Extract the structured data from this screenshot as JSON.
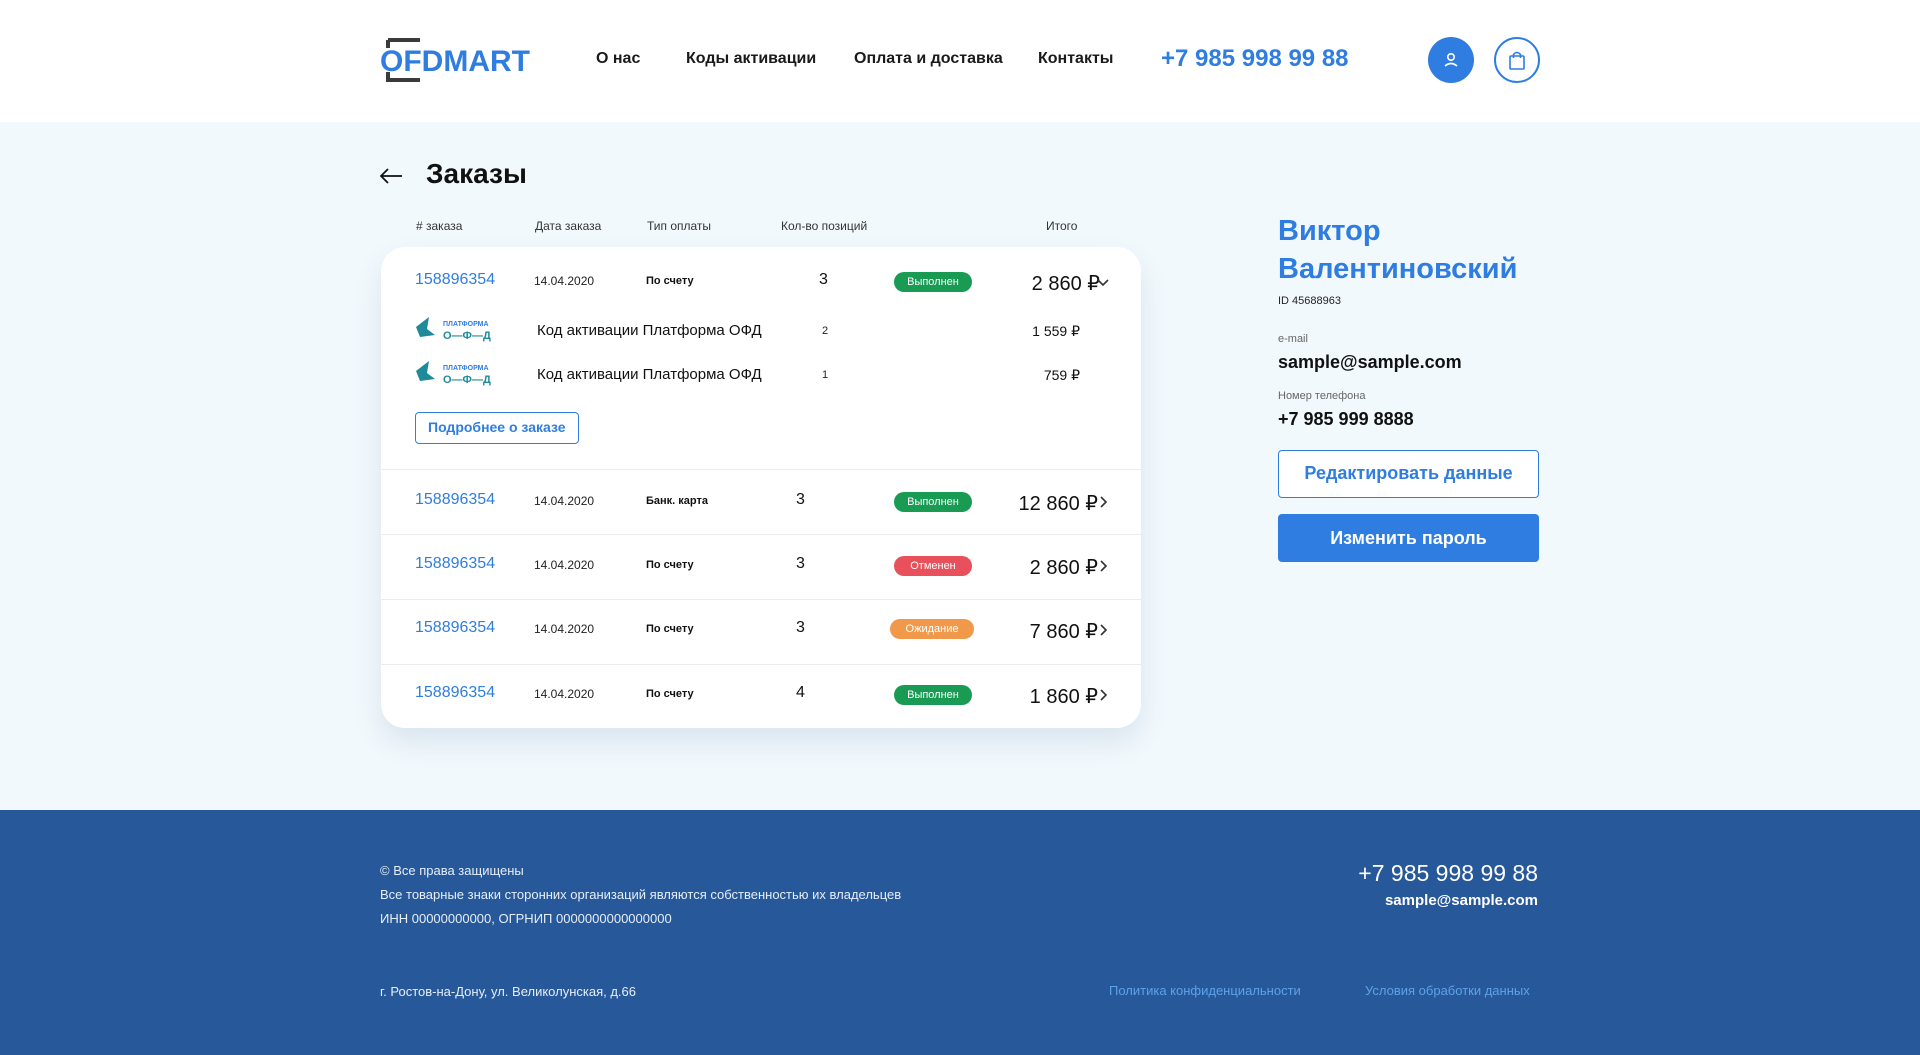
{
  "brand": {
    "logo_text": "OFDMART",
    "accent": "#2f7de1",
    "dark": "#3a3a3a"
  },
  "nav": {
    "items": [
      "О нас",
      "Коды активации",
      "Оплата и доставка",
      "Контакты"
    ],
    "phone": "+7 985 998 99 88"
  },
  "header_icons": {
    "user": "user-icon",
    "cart": "shopping-bag-icon"
  },
  "page": {
    "title": "Заказы"
  },
  "table": {
    "columns": [
      "# заказа",
      "Дата заказа",
      "Тип оплаты",
      "Кол-во позиций",
      "Итого"
    ]
  },
  "orders": [
    {
      "id": "158896354",
      "date": "14.04.2020",
      "payment": "По счету",
      "qty": "3",
      "status": "Выполнен",
      "status_color": "#1a9b54",
      "total": "2 860 ₽",
      "expanded": true,
      "items": [
        {
          "logo_line1": "ПЛАТФОРМА",
          "logo_line2": "О—Ф—Д",
          "name": "Код активации Платформа ОФД",
          "qty": "2",
          "price": "1 559 ₽"
        },
        {
          "logo_line1": "ПЛАТФОРМА",
          "logo_line2": "О—Ф—Д",
          "name": "Код активации Платформа ОФД",
          "qty": "1",
          "price": "759 ₽"
        }
      ],
      "details_label": "Подробнее о заказе"
    },
    {
      "id": "158896354",
      "date": "14.04.2020",
      "payment": "Банк. карта",
      "qty": "3",
      "status": "Выполнен",
      "status_color": "#1a9b54",
      "total": "12 860 ₽"
    },
    {
      "id": "158896354",
      "date": "14.04.2020",
      "payment": "По счету",
      "qty": "3",
      "status": "Отменен",
      "status_color": "#e8505b",
      "total": "2 860 ₽"
    },
    {
      "id": "158896354",
      "date": "14.04.2020",
      "payment": "По счету",
      "qty": "3",
      "status": "Ожидание",
      "status_color": "#f0994a",
      "total": "7 860 ₽"
    },
    {
      "id": "158896354",
      "date": "14.04.2020",
      "payment": "По счету",
      "qty": "4",
      "status": "Выполнен",
      "status_color": "#1a9b54",
      "total": "1 860 ₽"
    }
  ],
  "profile": {
    "name": "Виктор Валентиновский",
    "id": "ID 45688963",
    "email_label": "e-mail",
    "email": "sample@sample.com",
    "phone_label": "Номер телефона",
    "phone": "+7 985 999 8888",
    "edit_label": "Редактировать данные",
    "password_label": "Изменить пароль"
  },
  "footer": {
    "line1": "© Все права защищены",
    "line2": "Все товарные знаки сторонних организаций являются собственностью их владельцев",
    "line3": "ИНН 00000000000, ОГРНИП 0000000000000000",
    "address": "г. Ростов-на-Дону, ул. Великолунская, д.66",
    "phone": "+7 985 998 99 88",
    "email": "sample@sample.com",
    "privacy": "Политика конфиденциальности",
    "terms": "Условия обработки данных",
    "bg": "#27589a"
  }
}
